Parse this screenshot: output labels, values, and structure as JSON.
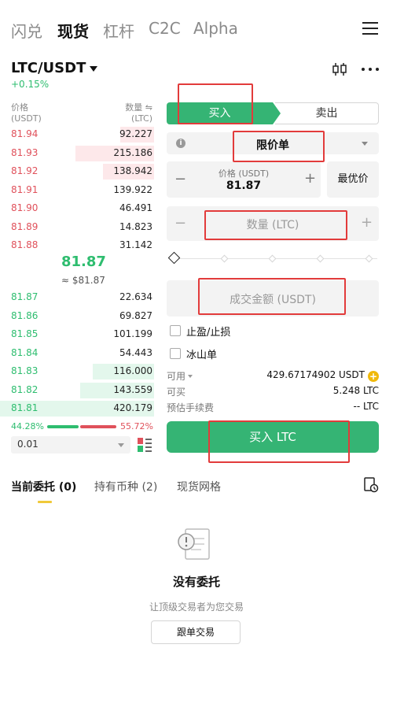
{
  "nav": {
    "tabs": [
      "闪兑",
      "现货",
      "杠杆",
      "C2C",
      "Alpha"
    ],
    "active": "现货"
  },
  "pair": {
    "symbol": "LTC/USDT",
    "change": "+0.15%"
  },
  "orderbook": {
    "price_header": "价格",
    "price_unit": "(USDT)",
    "qty_header": "数量 ⇋",
    "qty_unit": "(LTC)",
    "asks": [
      {
        "price": "81.94",
        "qty": "92.227",
        "depth": 0.22
      },
      {
        "price": "81.93",
        "qty": "215.186",
        "depth": 0.51
      },
      {
        "price": "81.92",
        "qty": "138.942",
        "depth": 0.33
      },
      {
        "price": "81.91",
        "qty": "139.922",
        "depth": 0.0
      },
      {
        "price": "81.90",
        "qty": "46.491",
        "depth": 0.0
      },
      {
        "price": "81.89",
        "qty": "14.823",
        "depth": 0.0
      },
      {
        "price": "81.88",
        "qty": "31.142",
        "depth": 0.0
      }
    ],
    "last_price": "81.87",
    "last_fiat": "≈ $81.87",
    "bids": [
      {
        "price": "81.87",
        "qty": "22.634",
        "depth": 0.0
      },
      {
        "price": "81.86",
        "qty": "69.827",
        "depth": 0.0
      },
      {
        "price": "81.85",
        "qty": "101.199",
        "depth": 0.0
      },
      {
        "price": "81.84",
        "qty": "54.443",
        "depth": 0.0
      },
      {
        "price": "81.83",
        "qty": "116.000",
        "depth": 0.4
      },
      {
        "price": "81.82",
        "qty": "143.559",
        "depth": 0.48
      },
      {
        "price": "81.81",
        "qty": "420.179",
        "depth": 1.0
      }
    ],
    "buy_ratio": "44.28%",
    "sell_ratio": "55.72%",
    "precision": "0.01"
  },
  "form": {
    "buy_tab": "买入",
    "sell_tab": "卖出",
    "order_type": "限价单",
    "price_label": "价格 (USDT)",
    "price_value": "81.87",
    "best_price": "最优价",
    "qty_placeholder": "数量 (LTC)",
    "amount_placeholder": "成交金额 (USDT)",
    "tp_sl": "止盈/止损",
    "iceberg": "冰山单",
    "available_label": "可用",
    "available_value": "429.67174902 USDT",
    "can_buy_label": "可买",
    "can_buy_value": "5.248 LTC",
    "fee_label": "预估手续费",
    "fee_value": "-- LTC",
    "submit": "买入 LTC",
    "minus": "−",
    "plus": "+"
  },
  "bottom": {
    "tabs": [
      "当前委托 (0)",
      "持有币种 (2)",
      "现货网格"
    ],
    "empty_title": "没有委托",
    "empty_sub": "让顶级交易者为您交易",
    "copy_trade": "跟单交易"
  },
  "colors": {
    "buy_green": "#35b474",
    "ask_red": "#e0515b",
    "highlight_red": "#e23b3b"
  }
}
